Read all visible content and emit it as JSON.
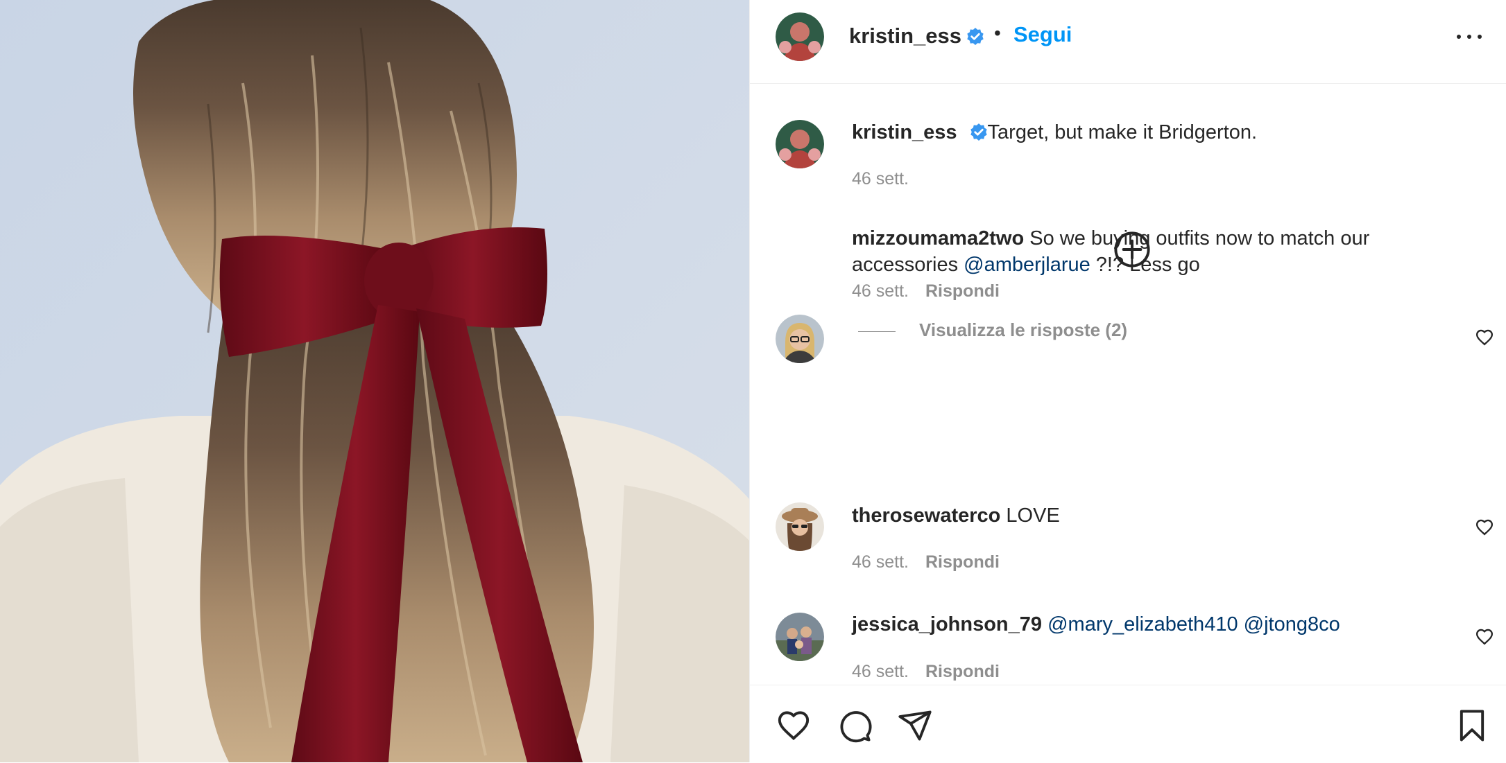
{
  "post": {
    "author": "kristin_ess",
    "follow_label": "Segui",
    "separator": "•",
    "caption": "Target, but make it Bridgerton.",
    "caption_time": "46 sett."
  },
  "comments": [
    {
      "username": "mizzoumama2two",
      "text_before": "So we buying outfits now to match our accessories ",
      "mention": "@amberjlarue",
      "text_after": " ?!? Less go",
      "time": "46 sett.",
      "reply_label": "Rispondi",
      "view_replies": "Visualizza le risposte (2)"
    },
    {
      "username": "therosewaterco",
      "text": "LOVE",
      "time": "46 sett.",
      "reply_label": "Rispondi"
    },
    {
      "username": "jessica_johnson_79",
      "mention1": "@mary_elizabeth410",
      "mention2": "@jtong8co",
      "time": "46 sett.",
      "reply_label": "Rispondi"
    }
  ],
  "icons": {
    "verified": "verified-badge-icon",
    "more": "more-options-icon",
    "add": "add-circle-icon",
    "like": "heart-icon",
    "comment": "comment-icon",
    "share": "share-icon",
    "save": "bookmark-icon"
  },
  "colors": {
    "accent": "#0095f6",
    "verified": "#3897f0",
    "mention": "#00376b",
    "secondary_text": "#8e8e8e"
  }
}
